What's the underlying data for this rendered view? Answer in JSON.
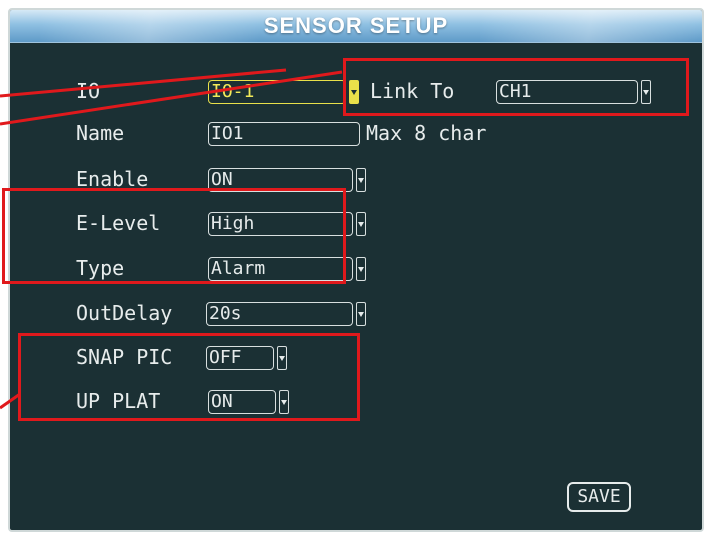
{
  "window": {
    "title": "SENSOR SETUP"
  },
  "form": {
    "io": {
      "label": "IO",
      "value": "IO-1"
    },
    "link_to": {
      "label": "Link To",
      "value": "CH1"
    },
    "name": {
      "label": "Name",
      "value": "IO1",
      "hint": "Max 8 char"
    },
    "enable": {
      "label": "Enable",
      "value": "ON"
    },
    "e_level": {
      "label": "E-Level",
      "value": "High"
    },
    "type": {
      "label": "Type",
      "value": "Alarm"
    },
    "out_delay": {
      "label": "OutDelay",
      "value": "20s"
    },
    "snap_pic": {
      "label": "SNAP PIC",
      "value": "OFF"
    },
    "up_plat": {
      "label": "UP PLAT",
      "value": "ON"
    }
  },
  "actions": {
    "save_label": "SAVE"
  },
  "colors": {
    "panel_bg": "#1b3034",
    "title_bar": "#7fb3da",
    "active_field": "#e9e04a",
    "callout": "#e0191c"
  },
  "icons": {
    "dropdown": "chevron-down-icon"
  }
}
